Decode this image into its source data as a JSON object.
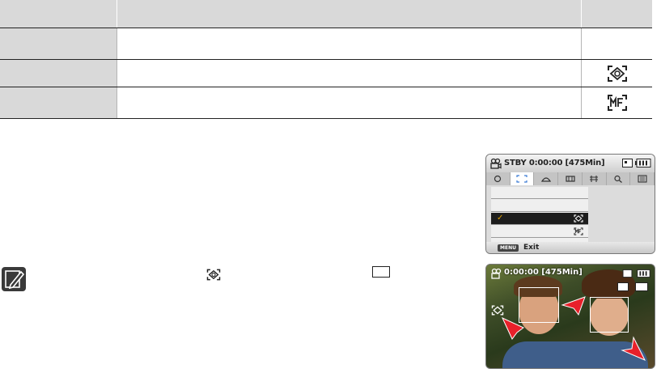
{
  "table": {
    "headers": [
      "",
      "",
      ""
    ],
    "rows": [
      {
        "label": "",
        "description": "",
        "icon": ""
      },
      {
        "label": "",
        "description": "",
        "icon": "face-detection-icon"
      },
      {
        "label": "",
        "description": "",
        "icon": "manual-focus-icon"
      }
    ]
  },
  "menu_screen": {
    "status_text": "STBY 0:00:00 [475Min]",
    "exit_button_label": "MENU",
    "exit_label": "Exit",
    "active_tab_index": 1,
    "selected_item_index": 2
  },
  "photo_screen": {
    "status_text": "0:00:00 [475Min]"
  },
  "colors": {
    "header_gray": "#d9d9d9",
    "menu_selected": "#1d1d1d",
    "arrow_red": "#e8202a",
    "check_orange": "#e0a000"
  }
}
